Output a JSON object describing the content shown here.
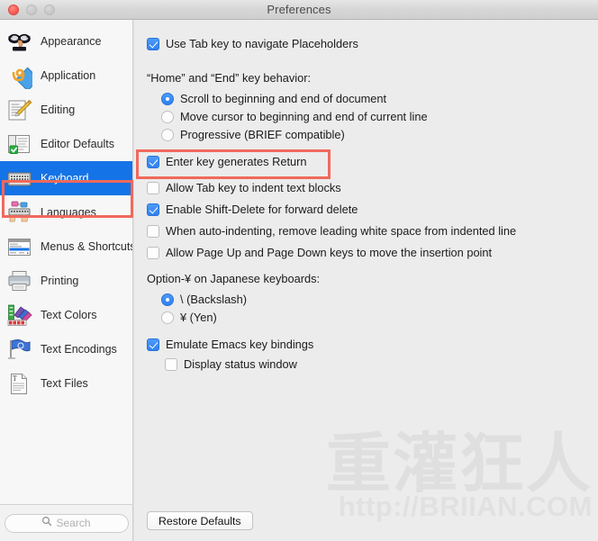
{
  "window": {
    "title": "Preferences",
    "traffic_lights": [
      {
        "name": "close-button",
        "color": "#f96058"
      },
      {
        "name": "minimize-button",
        "color": "#c9c9c9"
      },
      {
        "name": "maximize-button",
        "color": "#c9c9c9"
      }
    ]
  },
  "sidebar": {
    "items": [
      {
        "label": "Appearance",
        "icon": "disguise-glasses-icon",
        "selected": false
      },
      {
        "label": "Application",
        "icon": "app-diamond-icon",
        "selected": false
      },
      {
        "label": "Editing",
        "icon": "notepad-pencil-icon",
        "selected": false
      },
      {
        "label": "Editor Defaults",
        "icon": "editor-window-icon",
        "selected": false
      },
      {
        "label": "Keyboard",
        "icon": "keyboard-icon",
        "selected": true
      },
      {
        "label": "Languages",
        "icon": "typing-hands-icon",
        "selected": false
      },
      {
        "label": "Menus & Shortcuts",
        "icon": "menu-list-icon",
        "selected": false
      },
      {
        "label": "Printing",
        "icon": "printer-icon",
        "selected": false
      },
      {
        "label": "Text Colors",
        "icon": "color-palette-icon",
        "selected": false
      },
      {
        "label": "Text Encodings",
        "icon": "blue-flag-icon",
        "selected": false
      },
      {
        "label": "Text Files",
        "icon": "text-document-icon",
        "selected": false
      }
    ],
    "selection_color": "#1473e6",
    "search": {
      "placeholder": "Search",
      "icon": "search-icon"
    }
  },
  "main": {
    "use_tab_navigate": {
      "label": "Use Tab key to navigate Placeholders",
      "checked": true
    },
    "home_end_group": {
      "label": "“Home” and “End” key behavior:",
      "options": [
        {
          "label": "Scroll to beginning and end of document",
          "selected": true
        },
        {
          "label": "Move cursor to beginning and end of current line",
          "selected": false
        },
        {
          "label": "Progressive (BRIEF compatible)",
          "selected": false
        }
      ]
    },
    "checkboxes": [
      {
        "label": "Enter key generates Return",
        "checked": true,
        "highlighted": true
      },
      {
        "label": "Allow Tab key to indent text blocks",
        "checked": false,
        "highlighted": false
      },
      {
        "label": "Enable Shift-Delete for forward delete",
        "checked": true,
        "highlighted": false
      },
      {
        "label": "When auto-indenting, remove leading white space from indented line",
        "checked": false,
        "highlighted": false
      },
      {
        "label": "Allow Page Up and Page Down keys to move the insertion point",
        "checked": false,
        "highlighted": false
      }
    ],
    "japanese_group": {
      "label": "Option-¥ on Japanese keyboards:",
      "options": [
        {
          "label": "\\ (Backslash)",
          "selected": true
        },
        {
          "label": "¥ (Yen)",
          "selected": false
        }
      ]
    },
    "emacs": {
      "label": "Emulate Emacs key bindings",
      "checked": true
    },
    "emacs_status": {
      "label": "Display status window",
      "checked": false
    },
    "restore_button": "Restore Defaults",
    "highlight_color": "#f0695c"
  },
  "watermark": {
    "cjk": "重灌狂人",
    "url": "http://BRIIAN.COM"
  }
}
